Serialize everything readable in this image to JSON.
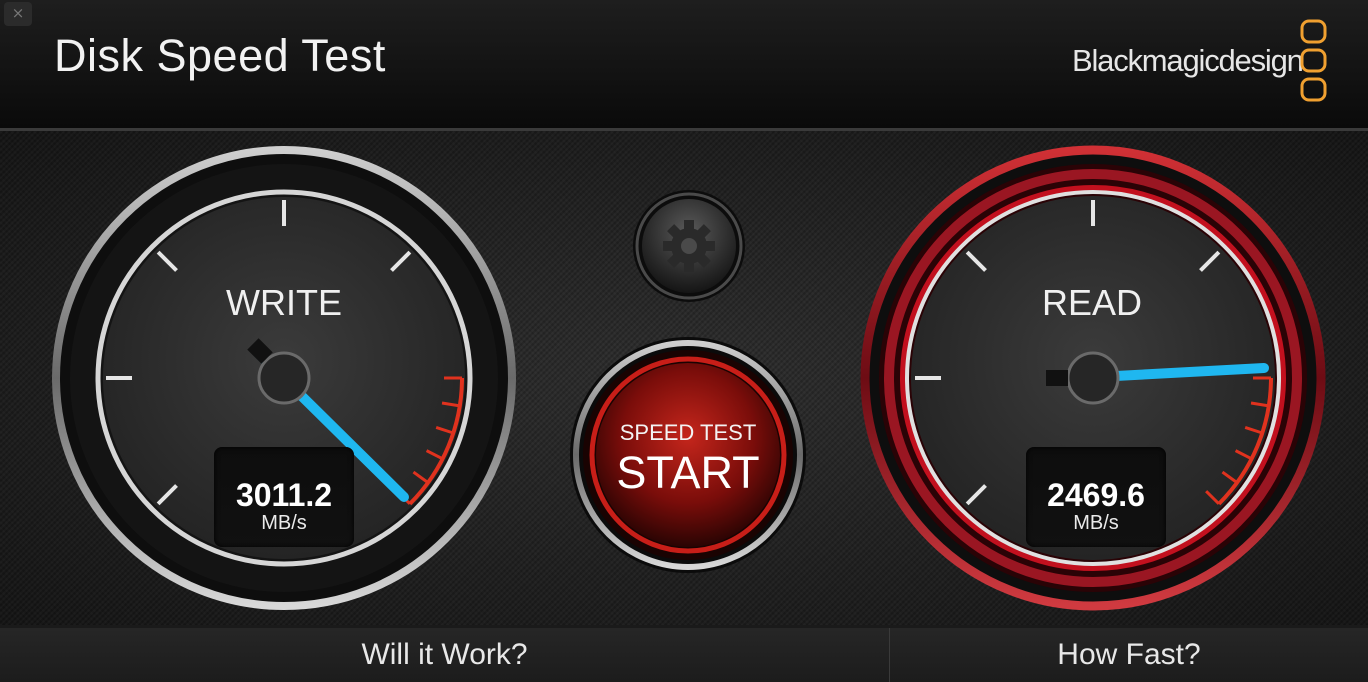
{
  "window": {
    "close_glyph": "×",
    "title": "Disk Speed Test",
    "brand": "Blackmagicdesign",
    "brand_color": "#f0a030"
  },
  "write_gauge": {
    "label": "WRITE",
    "value": "3011.2",
    "unit": "MB/s",
    "needle_color": "#1fb7f0"
  },
  "read_gauge": {
    "label": "READ",
    "value": "2469.6",
    "unit": "MB/s",
    "needle_color": "#1fb7f0",
    "ring_color": "#c0142a"
  },
  "start_button": {
    "small_label": "SPEED TEST",
    "big_label": "START"
  },
  "settings": {
    "icon": "gear-icon"
  },
  "footer": {
    "left_label": "Will it Work?",
    "right_label": "How Fast?"
  }
}
